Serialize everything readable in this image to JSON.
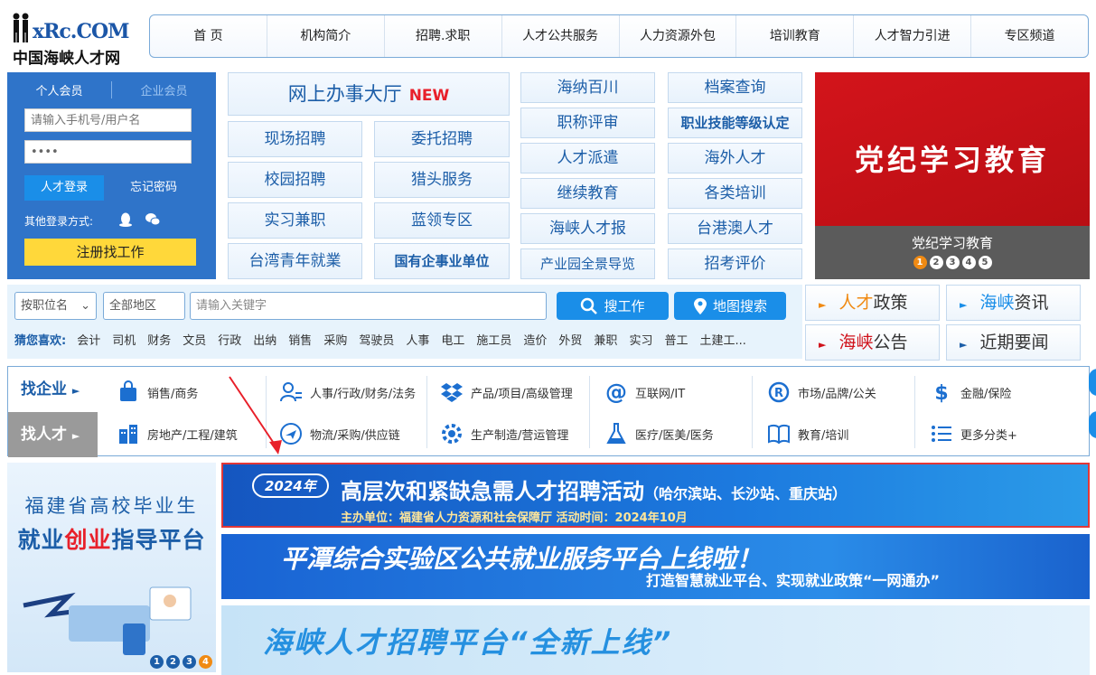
{
  "logo": {
    "brand": "xRc.COM",
    "brand_big": "R",
    "cn": "中国海峡人才网"
  },
  "nav": [
    "首 页",
    "机构简介",
    "招聘.求职",
    "人才公共服务",
    "人力资源外包",
    "培训教育",
    "人才智力引进",
    "专区频道"
  ],
  "login": {
    "tab_personal": "个人会员",
    "tab_company": "企业会员",
    "user_placeholder": "请输入手机号/用户名",
    "password_value": "••••",
    "login_btn": "人才登录",
    "forgot": "忘记密码",
    "other": "其他登录方式:",
    "register": "注册找工作"
  },
  "services": {
    "hall": "网上办事大厅",
    "hall_new": "NEW",
    "col1": [
      "现场招聘",
      "校园招聘",
      "实习兼职",
      "台湾青年就業"
    ],
    "col2": [
      "委托招聘",
      "猎头服务",
      "蓝领专区",
      "国有企事业单位"
    ],
    "col3": [
      "海纳百川",
      "职称评审",
      "人才派遣",
      "继续教育",
      "海峡人才报",
      "产业园全景导览"
    ],
    "col4": [
      "档案查询",
      "职业技能等级认定",
      "海外人才",
      "各类培训",
      "台港澳人才",
      "招考评价"
    ]
  },
  "party_banner": {
    "title": "党纪学习教育",
    "caption": "党纪学习教育",
    "dots": [
      "1",
      "2",
      "3",
      "4",
      "5"
    ]
  },
  "search": {
    "position_select": "按职位名",
    "area": "全部地区",
    "keyword_placeholder": "请输入关键字",
    "search_btn": "搜工作",
    "map_btn": "地图搜索",
    "guess_label": "猜您喜欢:",
    "keywords": [
      "会计",
      "司机",
      "财务",
      "文员",
      "行政",
      "出纳",
      "销售",
      "采购",
      "驾驶员",
      "人事",
      "电工",
      "施工员",
      "造价",
      "外贸",
      "兼职",
      "实习",
      "普工",
      "土建工..."
    ]
  },
  "news": [
    {
      "a": "人才",
      "b": "政策"
    },
    {
      "a": "海峡",
      "b": "资讯"
    },
    {
      "a": "海峡",
      "b": "公告"
    },
    {
      "a": "",
      "b": "近期要闻"
    }
  ],
  "categories": {
    "find_company": "找企业",
    "find_talent": "找人才",
    "row1": [
      "销售/商务",
      "人事/行政/财务/法务",
      "产品/项目/高级管理",
      "互联网/IT",
      "市场/品牌/公关",
      "金融/保险"
    ],
    "row2": [
      "房地产/工程/建筑",
      "物流/采购/供应链",
      "生产制造/营运管理",
      "医疗/医美/医务",
      "教育/培训",
      "更多分类+"
    ]
  },
  "promo": {
    "line1": "福建省高校毕业生",
    "line2a": "就业",
    "line2b": "创业",
    "line2c": "指导平台",
    "dots": [
      "1",
      "2",
      "3",
      "4"
    ]
  },
  "banners": {
    "b1_year": "2024年",
    "b1_title": "高层次和紧缺急需人才招聘活动",
    "b1_title_sub": "（哈尔滨站、长沙站、重庆站）",
    "b1_sub": "主办单位：福建省人力资源和社会保障厅    活动时间：2024年10月",
    "b2_title": "平潭综合实验区公共就业服务平台上线啦！",
    "b2_sub": "打造智慧就业平台、实现就业政策“一网通办”",
    "b3_title": "海峡人才招聘平台“全新上线”"
  }
}
